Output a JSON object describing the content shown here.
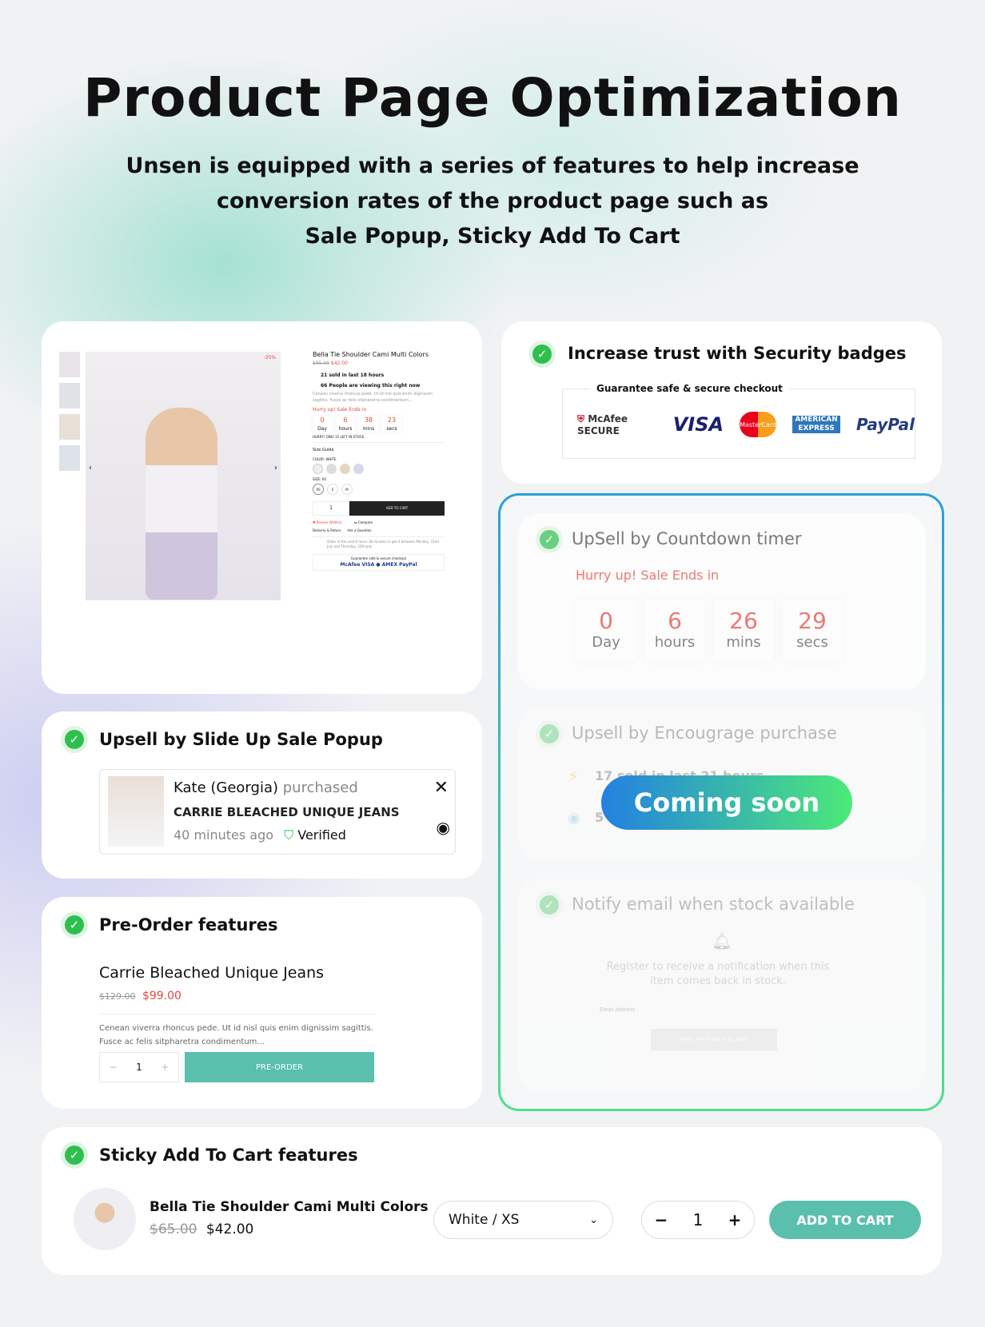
{
  "hero": {
    "title": "Product Page Optimization",
    "subtitle_lines": [
      "Unsen is equipped with a series of features to help increase",
      "conversion rates of the product page such as",
      "Sale Popup, Sticky Add To Cart"
    ]
  },
  "preview": {
    "product_title": "Bella Tie Shoulder Cami Multi Colors",
    "old_price": "$65.00",
    "price": "$42.00",
    "discount": "-35%",
    "sold": "21 sold in last 18 hours",
    "viewing": "66 People are viewing this right now",
    "description": "Cenean viverra rhoncus pede. Ut id nisl quis enim dignissim sagittis. Fusce ac felis sitpharetra condimentum...",
    "hurry": "Hurry up! Sale Ends in",
    "countdown": [
      {
        "v": "0",
        "l": "Day"
      },
      {
        "v": "6",
        "l": "hours"
      },
      {
        "v": "38",
        "l": "mins"
      },
      {
        "v": "23",
        "l": "secs"
      }
    ],
    "stock": "HURRY! ONLY 15 LEFT IN STOCK.",
    "size_guide": "Size Guide",
    "color_label": "COLOR: WHITE",
    "size_label": "SIZE: XS",
    "sizes": [
      "XS",
      "S",
      "M"
    ],
    "qty": "1",
    "add_to_cart": "ADD TO CART",
    "wishlist": "Browse Wishlist",
    "compare": "Compare",
    "delivery": "Delivery & Return",
    "ask": "Ask a Question",
    "order_note": "Order in the next 6 hours 38 minutes to get it between Monday, 22nd July and Thursday, 25th July",
    "guarantee": "Guarantee safe & secure checkout"
  },
  "security": {
    "title": "Increase trust with Security badges",
    "legend": "Guarantee safe & secure checkout",
    "badges": [
      "McAfee SECURE",
      "VISA",
      "MasterCard",
      "AMERICAN EXPRESS",
      "PayPal"
    ]
  },
  "countdown": {
    "title": "UpSell by Countdown timer",
    "hurry": "Hurry up! Sale Ends in",
    "units": [
      {
        "v": "0",
        "l": "Day"
      },
      {
        "v": "6",
        "l": "hours"
      },
      {
        "v": "26",
        "l": "mins"
      },
      {
        "v": "29",
        "l": "secs"
      }
    ]
  },
  "encourage": {
    "title": "Upsell by Encougrage purchase",
    "sold": "17 sold in last 21 hours",
    "viewing": "5",
    "badge": "Coming soon"
  },
  "notify": {
    "title": "Notify email when stock available",
    "text": "Register to receive a notification when this item comes back in stock.",
    "placeholder": "Email address",
    "button": "EMAIL ME WHEN AVAILABLE"
  },
  "popup": {
    "title": "Upsell by Slide Up Sale Popup",
    "name": "Kate (Georgia)",
    "action": "purchased",
    "product": "CARRIE BLEACHED UNIQUE JEANS",
    "time": "40 minutes ago",
    "verified": "Verified"
  },
  "preorder": {
    "title": "Pre-Order features",
    "product": "Carrie Bleached Unique Jeans",
    "old_price": "$129.00",
    "price": "$99.00",
    "description": "Cenean viverra rhoncus pede. Ut id nisl quis enim dignissim sagittis. Fusce ac felis sitpharetra condimentum...",
    "qty": "1",
    "button": "PRE-ORDER"
  },
  "sticky": {
    "title": "Sticky Add To Cart features",
    "product": "Bella Tie Shoulder Cami Multi Colors",
    "old_price": "$65.00",
    "price": "$42.00",
    "variant": "White / XS",
    "qty": "1",
    "button": "ADD TO CART"
  },
  "colors": {
    "accent": "#5bbfad",
    "sale": "#e8453c",
    "check": "#2fbf4e"
  }
}
